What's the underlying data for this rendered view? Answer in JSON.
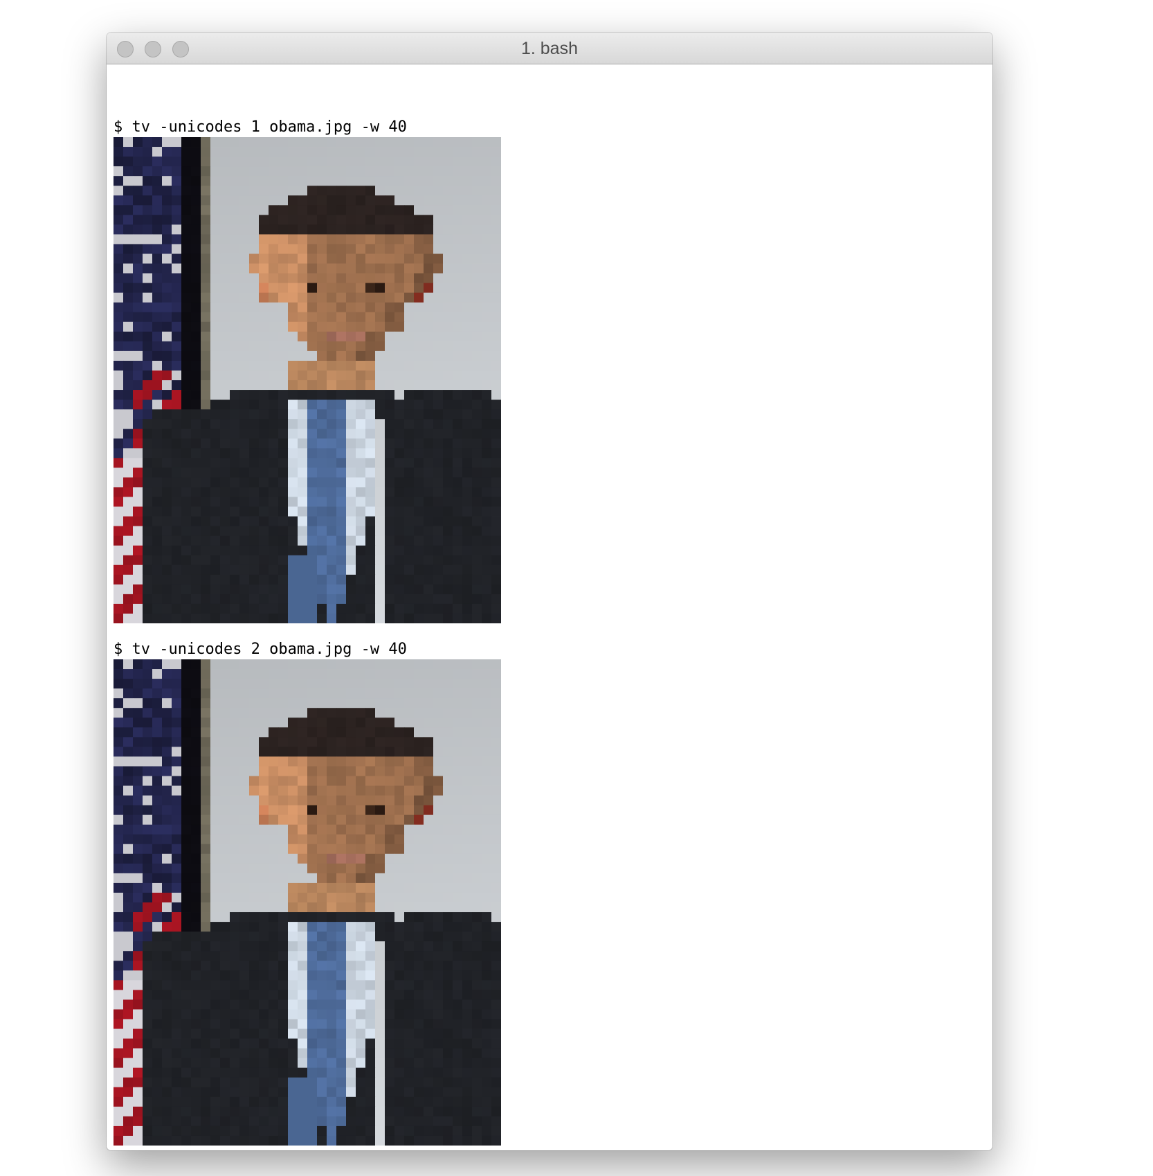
{
  "window": {
    "title": "1. bash"
  },
  "terminal": {
    "lines": [
      {
        "prompt": "$",
        "command": "tv -unicodes 1 obama.jpg -w 40"
      },
      {
        "prompt": "$",
        "command": "tv -unicodes 2 obama.jpg -w 40"
      },
      {
        "prompt": "$",
        "command": ""
      }
    ]
  },
  "colors": {
    "titlebar": "#dcdcdc",
    "terminal_bg": "#ffffff",
    "text": "#000000",
    "flag_red": "#a41421",
    "flag_blue": "#24264f",
    "suit": "#202227",
    "tie": "#4e6b9a",
    "skin": "#c98e64",
    "hair": "#2b2220",
    "backdrop": "#cfd3d7"
  }
}
